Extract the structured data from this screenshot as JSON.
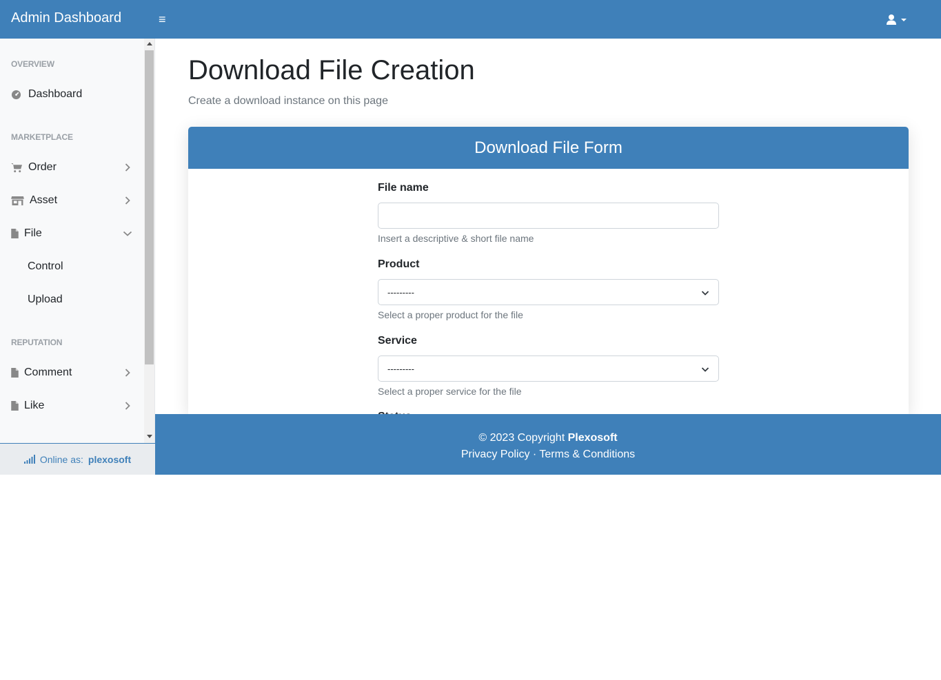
{
  "topbar": {
    "brand": "Admin Dashboard",
    "toggle_icon": "hamburger-icon",
    "user_icon": "user-icon"
  },
  "sidebar": {
    "sections": [
      {
        "heading": "OVERVIEW"
      },
      {
        "heading": "MARKETPLACE"
      },
      {
        "heading": "REPUTATION"
      }
    ],
    "items": [
      {
        "label": "Dashboard",
        "icon": "dashboard-icon"
      },
      {
        "label": "Order",
        "icon": "cart-icon"
      },
      {
        "label": "Asset",
        "icon": "store-icon"
      },
      {
        "label": "File",
        "icon": "file-icon",
        "expanded": true
      },
      {
        "label": "Control"
      },
      {
        "label": "Upload"
      },
      {
        "label": "Comment",
        "icon": "file-icon"
      },
      {
        "label": "Like",
        "icon": "file-icon"
      }
    ],
    "footer": {
      "label": "Online as:",
      "user": "plexosoft"
    }
  },
  "main": {
    "title": "Download File Creation",
    "subtitle": "Create a download instance on this page",
    "card": {
      "title": "Download File Form",
      "fields": [
        {
          "label": "File name",
          "value": "",
          "help": "Insert a descriptive & short file name"
        },
        {
          "label": "Product",
          "value": "---------",
          "help": "Select a proper product for the file"
        },
        {
          "label": "Service",
          "value": "---------",
          "help": "Select a proper service for the file"
        },
        {
          "label": "Status"
        }
      ]
    }
  },
  "footer": {
    "copyright": "© 2023 Copyright",
    "company": "Plexosoft",
    "privacy": "Privacy Policy",
    "separator": "·",
    "terms": "Terms & Conditions"
  },
  "colors": {
    "primary": "#3f80b9",
    "sidebar_bg": "#f8f9fa",
    "muted_text": "#6c757d"
  }
}
